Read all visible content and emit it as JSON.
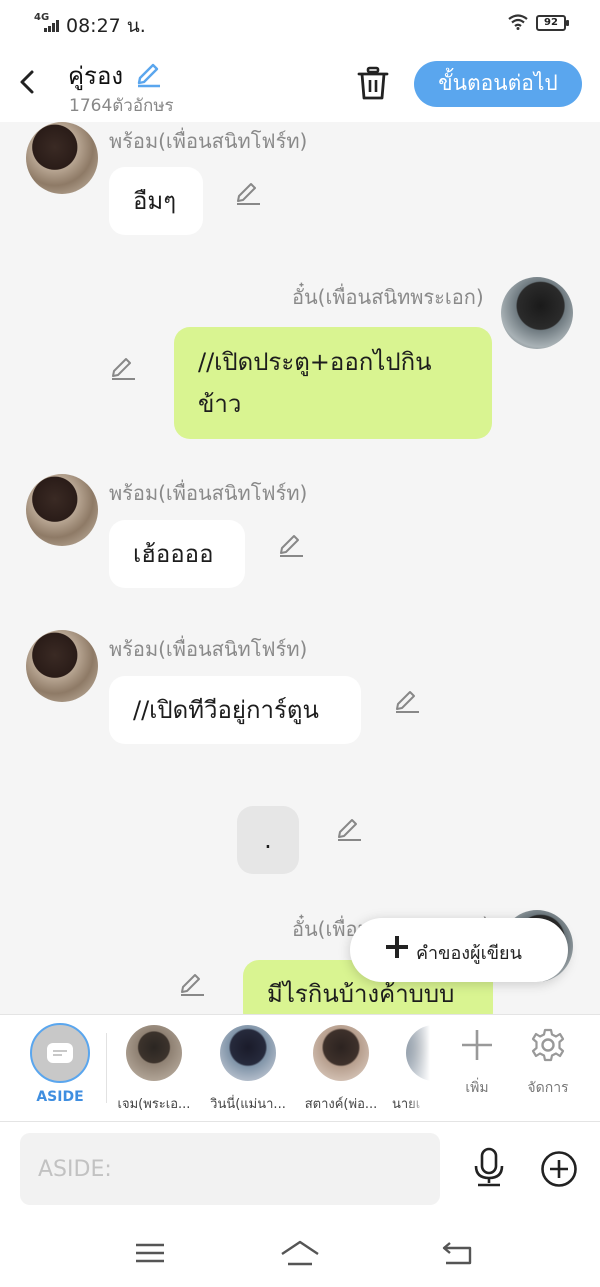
{
  "status_bar": {
    "network": "4G",
    "time": "08:27 น.",
    "battery": "92"
  },
  "header": {
    "title": "คู่รอง",
    "char_count": "1764ตัวอักษร",
    "next_label": "ขั้นตอนต่อไป"
  },
  "chat": {
    "messages": [
      {
        "side": "left",
        "name": "พร้อม(เพื่อนสนิทโฟร์ท)",
        "text": "อืมๆ"
      },
      {
        "side": "right",
        "name": "อั๋น(เพื่อนสนิทพระเอก)",
        "text_line1": "//เปิดประตู+ออกไปกิน",
        "text_line2": "ข้าว"
      },
      {
        "side": "left",
        "name": "พร้อม(เพื่อนสนิทโฟร์ท)",
        "text": "เฮ้ออออ"
      },
      {
        "side": "left",
        "name": "พร้อม(เพื่อนสนิทโฟร์ท)",
        "text": "//เปิดทีวีอยู่การ์ตูน"
      },
      {
        "side": "aside",
        "text": "."
      },
      {
        "side": "right",
        "name": "อั๋น(เพื่อน",
        "name_tail": ")",
        "text": "มีไรกินบ้างค้าบบบ"
      }
    ]
  },
  "fab": {
    "label": "คำของผู้เขียน"
  },
  "character_bar": {
    "aside_label": "ASIDE",
    "characters": [
      {
        "label": "เจม(พระเอ..."
      },
      {
        "label": "วินนี่(แม่นา..."
      },
      {
        "label": "สตางค์(พ่อ..."
      },
      {
        "label": "นายเ"
      }
    ],
    "add_label": "เพิ่ม",
    "manage_label": "จัดการ"
  },
  "input": {
    "placeholder": "ASIDE:"
  },
  "colors": {
    "accent": "#5aa6ee",
    "green_bubble": "#d9f491",
    "white_bubble": "#ffffff",
    "aside_bubble": "#e6e6e6"
  },
  "icons": [
    "back-arrow-icon",
    "pencil-icon",
    "trash-icon",
    "plus-icon",
    "aside-chat-icon",
    "gear-icon",
    "microphone-icon",
    "add-circle-icon",
    "menu-icon",
    "home-icon",
    "return-icon"
  ]
}
